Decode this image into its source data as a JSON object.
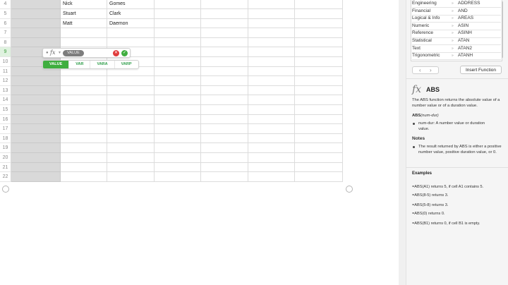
{
  "sheet": {
    "rows": [
      {
        "num": "4",
        "first": "Nick",
        "last": "Gomes",
        "active": false
      },
      {
        "num": "5",
        "first": "Stuart",
        "last": "Clark",
        "active": false
      },
      {
        "num": "6",
        "first": "Matt",
        "last": "Daemon",
        "active": false
      },
      {
        "num": "7",
        "first": "",
        "last": "",
        "active": false
      },
      {
        "num": "8",
        "first": "",
        "last": "",
        "active": false
      },
      {
        "num": "9",
        "first": "",
        "last": "",
        "active": true
      },
      {
        "num": "10",
        "first": "",
        "last": "",
        "active": false
      },
      {
        "num": "11",
        "first": "",
        "last": "",
        "active": false
      },
      {
        "num": "12",
        "first": "",
        "last": "",
        "active": false
      },
      {
        "num": "13",
        "first": "",
        "last": "",
        "active": false
      },
      {
        "num": "14",
        "first": "",
        "last": "",
        "active": false
      },
      {
        "num": "15",
        "first": "",
        "last": "",
        "active": false
      },
      {
        "num": "16",
        "first": "",
        "last": "",
        "active": false
      },
      {
        "num": "17",
        "first": "",
        "last": "",
        "active": false
      },
      {
        "num": "18",
        "first": "",
        "last": "",
        "active": false
      },
      {
        "num": "19",
        "first": "",
        "last": "",
        "active": false
      },
      {
        "num": "20",
        "first": "",
        "last": "",
        "active": false
      },
      {
        "num": "21",
        "first": "",
        "last": "",
        "active": false
      },
      {
        "num": "22",
        "first": "",
        "last": "",
        "active": false
      }
    ]
  },
  "formula": {
    "token": "VALUE",
    "cancel_glyph": "✕",
    "accept_glyph": "✓"
  },
  "suggestions": [
    "VALUE",
    "VAR",
    "VARA",
    "VARP"
  ],
  "functions": {
    "list": [
      {
        "category": "Engineering",
        "name": "ADDRESS"
      },
      {
        "category": "Financial",
        "name": "AND"
      },
      {
        "category": "Logical & Info",
        "name": "AREAS"
      },
      {
        "category": "Numeric",
        "name": "ASIN"
      },
      {
        "category": "Reference",
        "name": "ASINH"
      },
      {
        "category": "Statistical",
        "name": "ATAN"
      },
      {
        "category": "Text",
        "name": "ATAN2"
      },
      {
        "category": "Trigonometric",
        "name": "ATANH"
      }
    ],
    "insert_label": "Insert Function"
  },
  "help": {
    "fx": "fx",
    "title": "ABS",
    "description": "The ABS function returns the absolute value of a number value or of a duration value.",
    "syntax_name": "ABS",
    "syntax_args": "(num-dur)",
    "arg_text": "num-dur: A number value or duration value.",
    "notes_head": "Notes",
    "note_text": "The result returned by ABS is either a positive number value, positive duration value, or 0.",
    "examples_head": "Examples",
    "examples": [
      "=ABS(A1) returns 5, if cell A1 contains 5.",
      "=ABS(8-5) returns 3.",
      "=ABS(5-8) returns 3.",
      "=ABS(0) returns 0.",
      "=ABS(B1) returns 0, if cell B1 is empty."
    ]
  }
}
